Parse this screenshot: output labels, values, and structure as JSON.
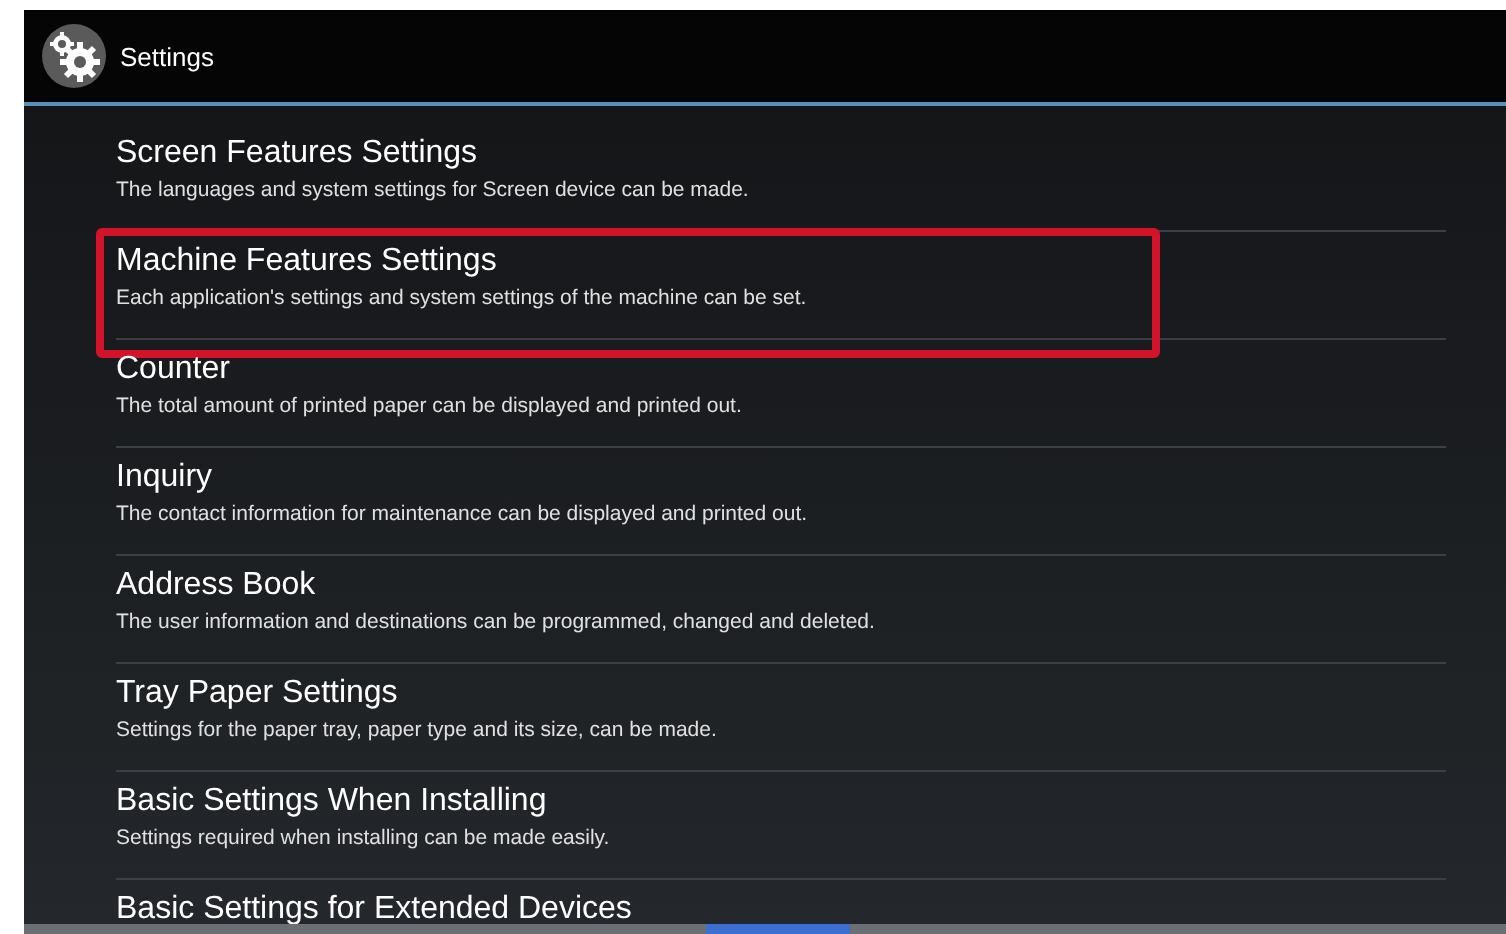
{
  "header": {
    "title": "Settings"
  },
  "items": [
    {
      "title": "Screen Features Settings",
      "description": "The languages and system settings for Screen device can be made.",
      "highlighted": false
    },
    {
      "title": "Machine Features Settings",
      "description": "Each application's settings and system settings of the machine can be set.",
      "highlighted": true
    },
    {
      "title": "Counter",
      "description": "The total amount of printed paper can be displayed and printed out.",
      "highlighted": false
    },
    {
      "title": "Inquiry",
      "description": "The contact information for maintenance can be displayed and printed out.",
      "highlighted": false
    },
    {
      "title": "Address Book",
      "description": "The user information and destinations can be programmed, changed and deleted.",
      "highlighted": false
    },
    {
      "title": "Tray Paper Settings",
      "description": "Settings for the paper tray, paper type and its size, can be made.",
      "highlighted": false
    },
    {
      "title": "Basic Settings When Installing",
      "description": "Settings required when installing can be made easily.",
      "highlighted": false
    },
    {
      "title": "Basic Settings for Extended Devices",
      "highlighted": false
    }
  ]
}
